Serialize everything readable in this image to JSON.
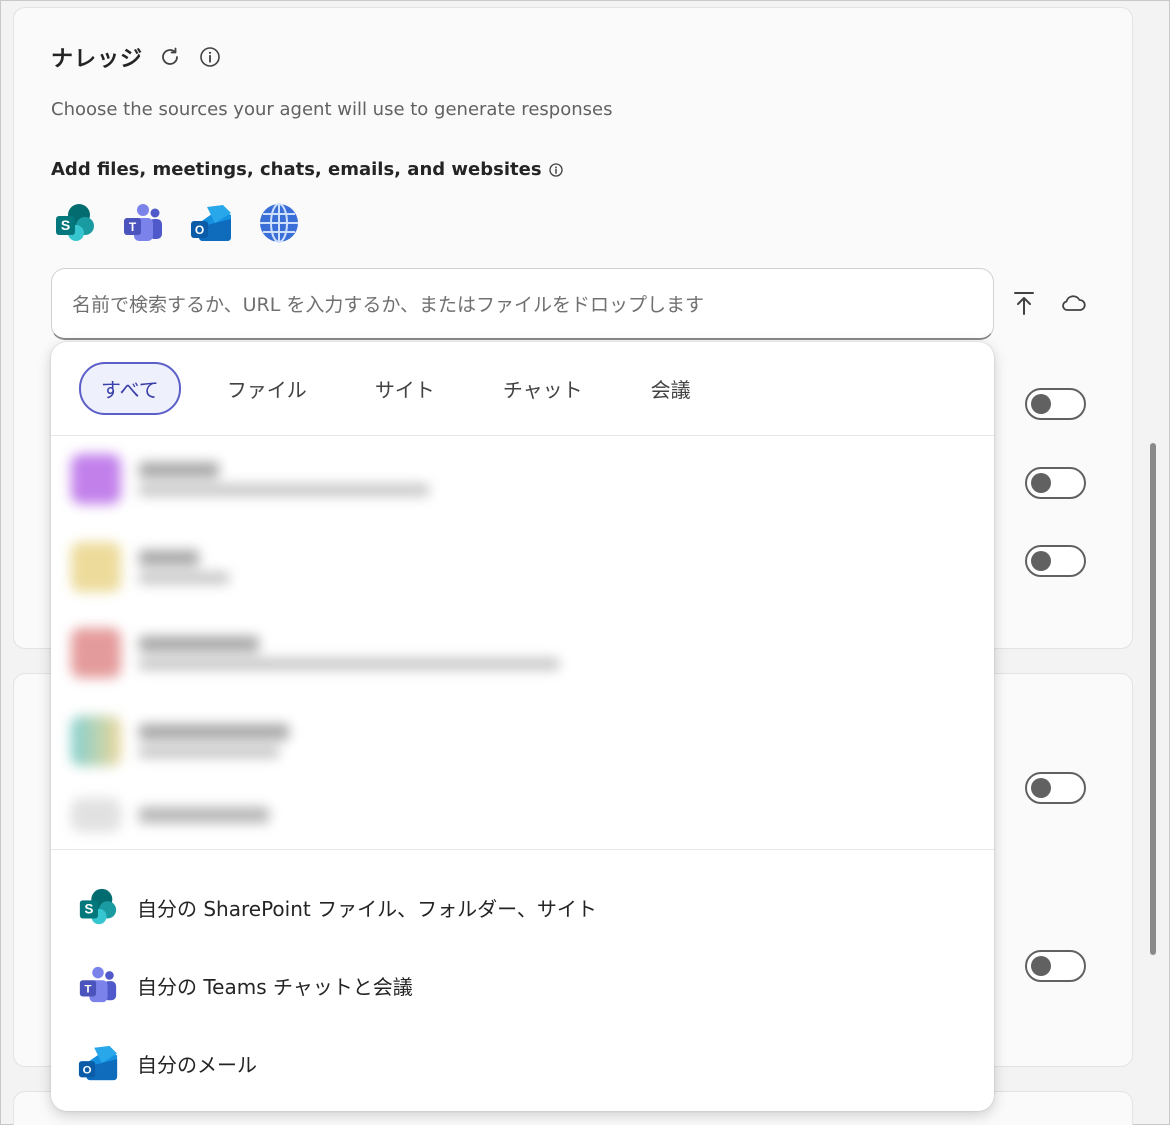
{
  "knowledge": {
    "title": "ナレッジ",
    "subtitle": "Choose the sources your agent will use to generate responses",
    "section_label": "Add files, meetings, chats, emails, and websites"
  },
  "app_icons": [
    "sharepoint-icon",
    "teams-icon",
    "outlook-icon",
    "globe-icon"
  ],
  "search": {
    "placeholder": "名前で検索するか、URL を入力するか、またはファイルをドロップします"
  },
  "tabs": [
    "すべて",
    "ファイル",
    "サイト",
    "チャット",
    "会議"
  ],
  "active_tab": "すべて",
  "sources": [
    {
      "icon": "sharepoint-icon",
      "label": "自分の SharePoint ファイル、フォルダー、サイト"
    },
    {
      "icon": "teams-icon",
      "label": "自分の Teams チャットと会議"
    },
    {
      "icon": "outlook-icon",
      "label": "自分のメール"
    }
  ],
  "toggles": [
    {
      "state": "off"
    },
    {
      "state": "off"
    },
    {
      "state": "off"
    },
    {
      "state": "off"
    },
    {
      "state": "off"
    }
  ],
  "colors": {
    "accent": "#5b5fc7",
    "sharepoint": "#03787c",
    "teams": "#5b5fc7",
    "outlook": "#0f6cbd"
  }
}
